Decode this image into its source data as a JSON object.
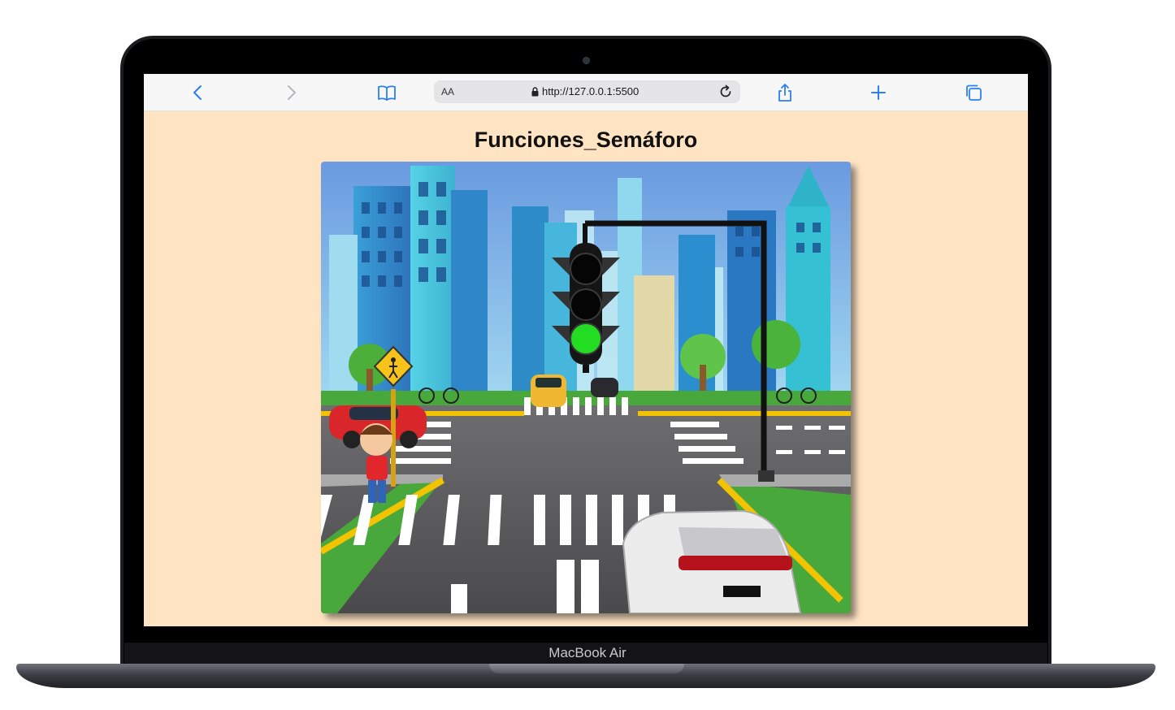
{
  "device": {
    "label": "MacBook Air"
  },
  "browser": {
    "address_prefix": "AA",
    "url": "http://127.0.0.1:5500",
    "icons": [
      "chevron-left-icon",
      "chevron-right-icon",
      "book-icon",
      "lock-icon",
      "reload-icon",
      "share-icon",
      "plus-icon",
      "tabs-icon"
    ]
  },
  "page": {
    "title": "Funciones_Semáforo",
    "background_color": "#ffe4c4"
  },
  "traffic_light": {
    "lights": [
      "off",
      "off",
      "on"
    ],
    "active_color": "#22dd22",
    "active_light": "green"
  }
}
